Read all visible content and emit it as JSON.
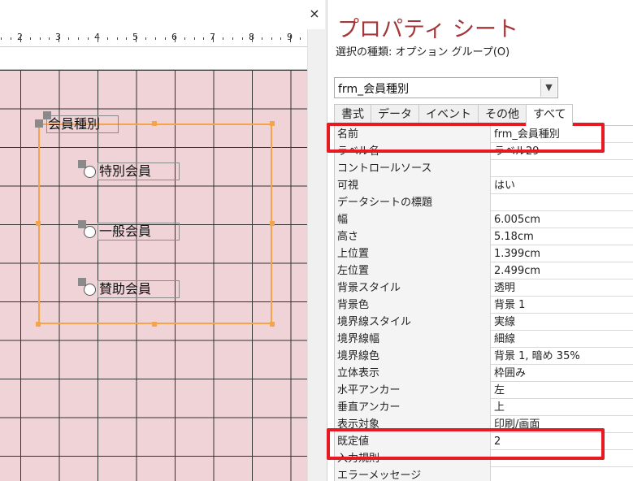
{
  "design": {
    "close_glyph": "×",
    "ruler_numbers": [
      "2",
      "3",
      "4",
      "5",
      "6",
      "7",
      "8",
      "9"
    ],
    "controls": {
      "group_label": "会員種別",
      "options": [
        "特別会員",
        "一般会員",
        "賛助会員"
      ]
    }
  },
  "sheet": {
    "title": "プロパティ シート",
    "selection_type": "選択の種類: オプション グループ(O)",
    "object_name": "frm_会員種別",
    "tabs": [
      "書式",
      "データ",
      "イベント",
      "その他",
      "すべて"
    ],
    "active_tab": "すべて",
    "properties": [
      {
        "name": "名前",
        "value": "frm_会員種別"
      },
      {
        "name": "ラベル名",
        "value": "ラベル29"
      },
      {
        "name": "コントロールソース",
        "value": ""
      },
      {
        "name": "可視",
        "value": "はい"
      },
      {
        "name": "データシートの標題",
        "value": ""
      },
      {
        "name": "幅",
        "value": "6.005cm"
      },
      {
        "name": "高さ",
        "value": "5.18cm"
      },
      {
        "name": "上位置",
        "value": "1.399cm"
      },
      {
        "name": "左位置",
        "value": "2.499cm"
      },
      {
        "name": "背景スタイル",
        "value": "透明"
      },
      {
        "name": "背景色",
        "value": "背景 1"
      },
      {
        "name": "境界線スタイル",
        "value": "実線"
      },
      {
        "name": "境界線幅",
        "value": "細線"
      },
      {
        "name": "境界線色",
        "value": "背景 1, 暗め 35%"
      },
      {
        "name": "立体表示",
        "value": "枠囲み"
      },
      {
        "name": "水平アンカー",
        "value": "左"
      },
      {
        "name": "垂直アンカー",
        "value": "上"
      },
      {
        "name": "表示対象",
        "value": "印刷/画面"
      },
      {
        "name": "既定値",
        "value": "2"
      },
      {
        "name": "入力規則",
        "value": ""
      },
      {
        "name": "エラーメッセージ",
        "value": ""
      }
    ]
  },
  "colors": {
    "title": "#a4373a",
    "grid_background": "#efd3d6",
    "selection_frame": "#f4a54a",
    "highlight_box": "#e61a23"
  }
}
